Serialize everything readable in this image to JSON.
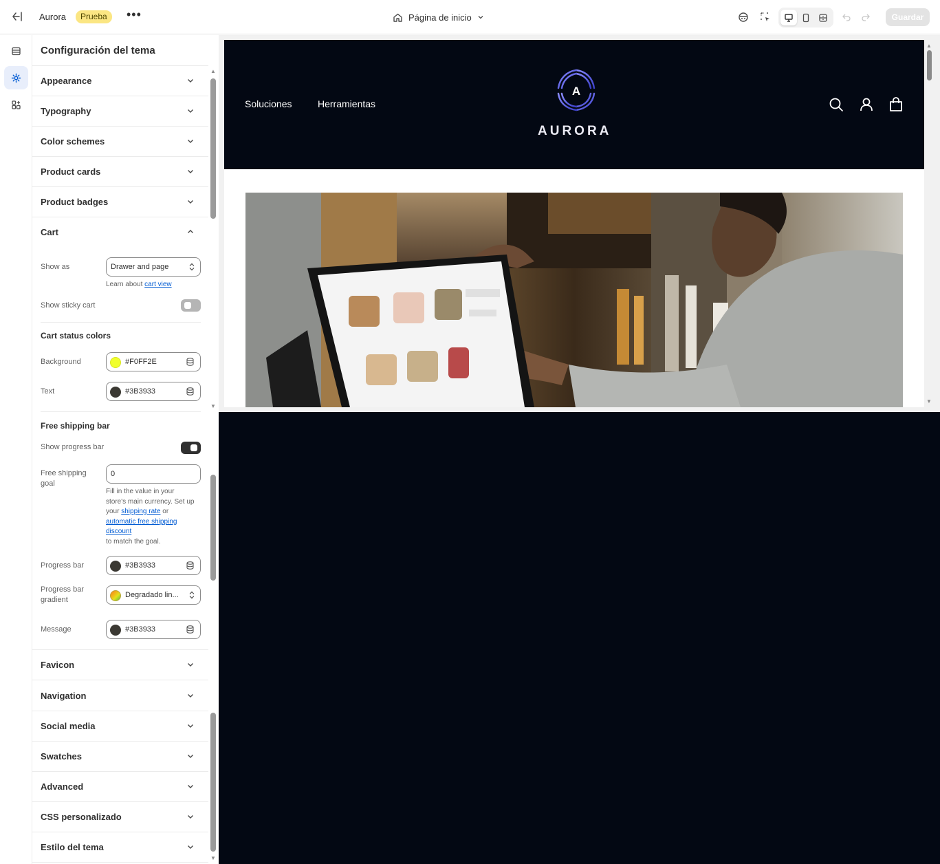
{
  "topbar": {
    "store_name": "Aurora",
    "badge": "Prueba",
    "more": "•••",
    "page_selector": "Página de inicio",
    "save_label": "Guardar"
  },
  "panel": {
    "title": "Configuración del tema",
    "sections_top": [
      "Appearance",
      "Typography",
      "Color schemes",
      "Product cards",
      "Product badges",
      "Cart"
    ],
    "cart": {
      "show_as_label": "Show as",
      "show_as_value": "Drawer and page",
      "learn_prefix": "Learn about",
      "learn_link": "cart view",
      "sticky_label": "Show sticky cart",
      "sticky_on": false,
      "status_colors_heading": "Cart status colors",
      "background_label": "Background",
      "background_value": "#F0FF2E",
      "text_label": "Text",
      "text_value": "#3B3933"
    },
    "free_shipping": {
      "heading": "Free shipping bar",
      "show_progress_label": "Show progress bar",
      "show_progress_on": true,
      "goal_label_1": "Free shipping",
      "goal_label_2": "goal",
      "goal_value": "0",
      "help_1": "Fill in the value in your",
      "help_2": "store's main currency. Set up",
      "help_3": "your",
      "help_link_1": "shipping rate",
      "help_or": "or",
      "help_link_2a": "automatic free shipping",
      "help_link_2b": "discount",
      "help_4": "to match the goal.",
      "progress_label": "Progress bar",
      "progress_value": "#3B3933",
      "gradient_label_1": "Progress bar",
      "gradient_label_2": "gradient",
      "gradient_value": "Degradado lin...",
      "message_label": "Message",
      "message_value": "#3B3933"
    },
    "sections_bottom": [
      "Favicon",
      "Navigation",
      "Social media",
      "Swatches",
      "Advanced",
      "CSS personalizado",
      "Estilo del tema"
    ]
  },
  "preview": {
    "nav": [
      "Soluciones",
      "Herramientas"
    ],
    "logo_letter": "A",
    "logo_text": "AURORA"
  },
  "colors": {
    "cart_background": "#F0FF2E",
    "text": "#3B3933",
    "header_bg": "#030813"
  }
}
